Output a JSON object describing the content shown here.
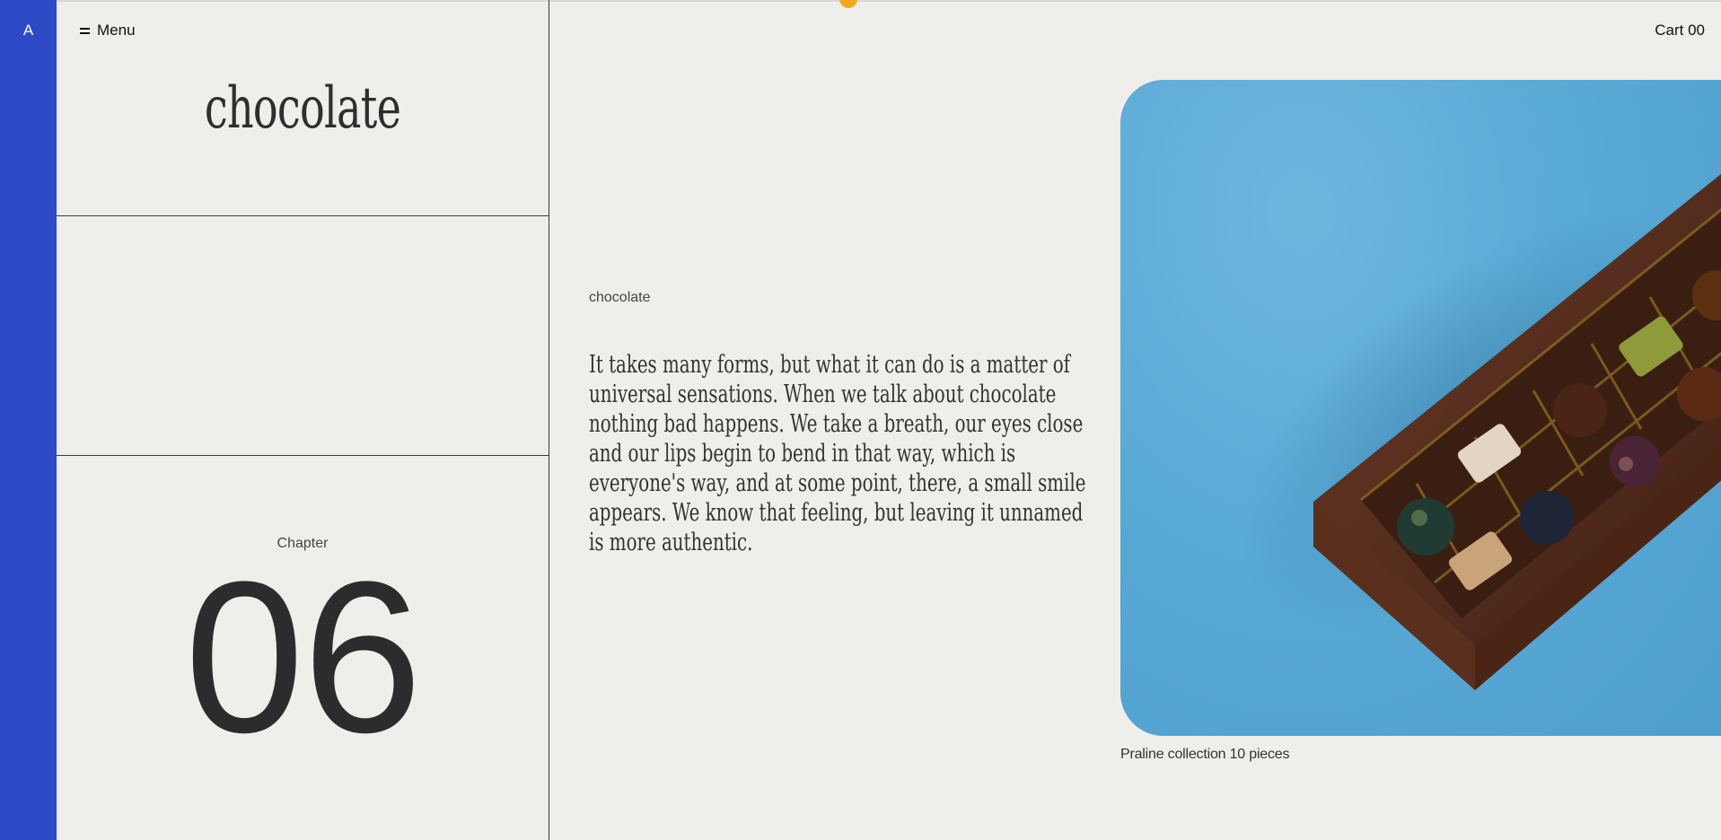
{
  "rail": {
    "logo": "A"
  },
  "header": {
    "menu_label": "Menu",
    "cart_label": "Cart 00"
  },
  "left": {
    "title": "chocolate",
    "chapter_label": "Chapter",
    "chapter_number": "06"
  },
  "main": {
    "section_label": "chocolate",
    "body": "It takes many forms, but what it can do is a matter of universal sensations. When we talk about chocolate nothing bad happens. We take a breath, our eyes close and our lips begin to bend in that way, which is everyone's way, and at some point, there, a small smile appears. We know that feeling, but leaving it unnamed is more authentic."
  },
  "product": {
    "caption": "Praline collection 10 pieces"
  },
  "colors": {
    "rail": "#2e49c6",
    "background": "#efeeea",
    "accent_dot": "#f2a81d",
    "photo_background": "#5aaad6"
  }
}
